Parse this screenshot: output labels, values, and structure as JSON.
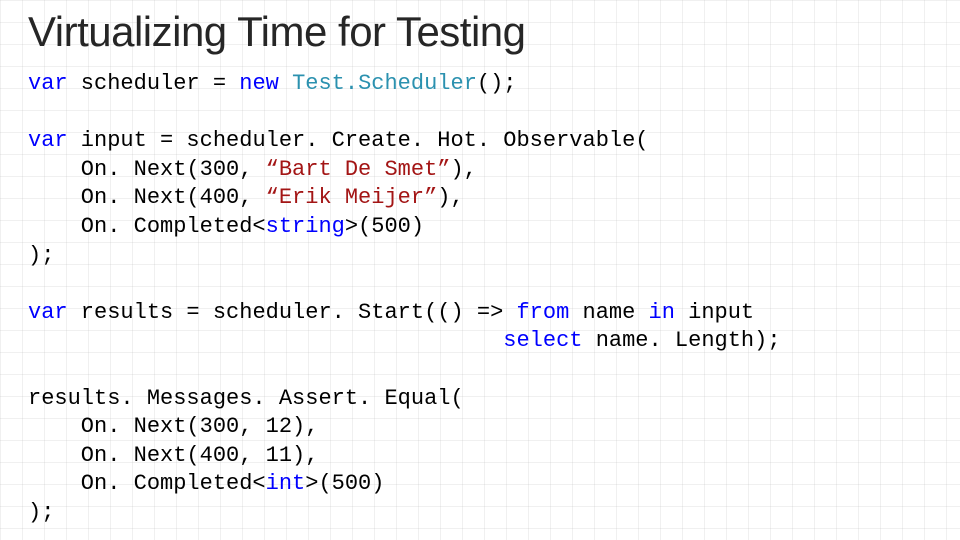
{
  "title": "Virtualizing Time for Testing",
  "tokens": {
    "kw_var": "var",
    "kw_new": "new",
    "kw_string": "string",
    "kw_int": "int",
    "kw_from": "from",
    "kw_in": "in",
    "kw_select": "select",
    "type_TestScheduler": "Test.Scheduler",
    "str_bart": "“Bart De Smet”",
    "str_erik": "“Erik Meijer”"
  },
  "code": {
    "l01a": " scheduler = ",
    "l01b": "();",
    "l02a": " input = scheduler. Create. Hot. Observable(",
    "l03a": "    On. Next(300, ",
    "l03b": "),",
    "l04a": "    On. Next(400, ",
    "l04b": "),",
    "l05a": "    On. Completed<",
    "l05b": ">(500)",
    "l06a": ");",
    "l07a": " results = scheduler. Start(() => ",
    "l07b": " name ",
    "l07c": " input",
    "l08a": "                                    ",
    "l08b": " name. Length);",
    "l09a": "results. Messages. Assert. Equal(",
    "l10a": "    On. Next(300, 12),",
    "l11a": "    On. Next(400, 11),",
    "l12a": "    On. Completed<",
    "l12b": ">(500)",
    "l13a": ");"
  }
}
